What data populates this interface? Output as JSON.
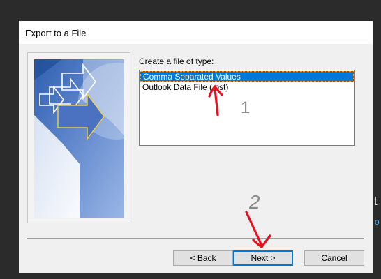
{
  "dialog": {
    "title": "Export to a File",
    "file_type_label": "Create a file of type:",
    "file_types": [
      "Comma Separated Values",
      "Outlook Data File (.pst)"
    ],
    "selected_index": 0,
    "buttons": {
      "back": "< Back",
      "next": "Next >",
      "cancel": "Cancel"
    }
  },
  "annotations": {
    "step_1": "1",
    "step_2": "2"
  },
  "background": {
    "right_edge_text": "t",
    "right_edge_link": "o"
  },
  "colors": {
    "selection": "#0078d7",
    "annotation_red": "#e8101e",
    "dialog_bg": "#f0f0f0",
    "backdrop": "#2b2b2b"
  }
}
